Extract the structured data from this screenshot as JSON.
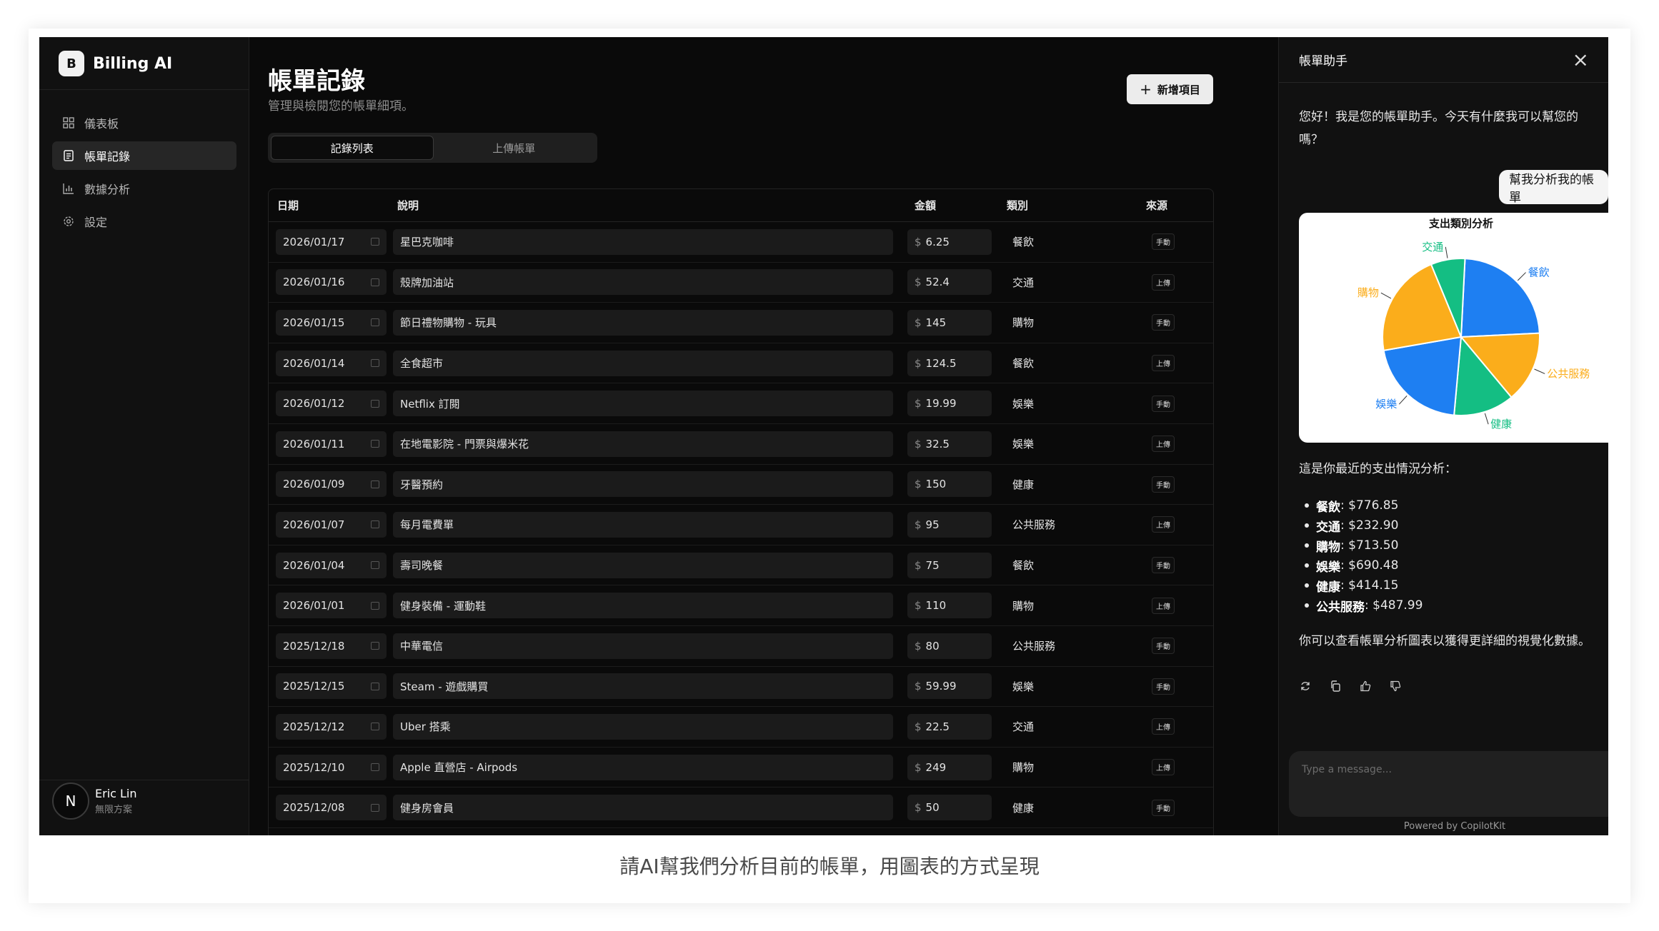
{
  "brand": {
    "logo_letter": "B",
    "name": "Billing AI"
  },
  "nav": [
    {
      "label": "儀表板",
      "icon": "dashboard-icon",
      "active": false
    },
    {
      "label": "帳單記錄",
      "icon": "receipt-icon",
      "active": true
    },
    {
      "label": "數據分析",
      "icon": "bar-chart-icon",
      "active": false
    },
    {
      "label": "設定",
      "icon": "gear-icon",
      "active": false
    }
  ],
  "user": {
    "initial": "N",
    "name": "Eric Lin",
    "plan": "無限方案"
  },
  "page": {
    "title": "帳單記錄",
    "subtitle": "管理與檢閱您的帳單細項。",
    "add_label": "新增項目"
  },
  "tabs": [
    {
      "label": "記錄列表",
      "active": true
    },
    {
      "label": "上傳帳單",
      "active": false
    }
  ],
  "table": {
    "headers": {
      "date": "日期",
      "desc": "說明",
      "amount": "金額",
      "category": "類別",
      "source": "來源"
    },
    "currency": "$",
    "rows": [
      {
        "date": "2026/01/17",
        "desc": "星巴克咖啡",
        "amount": "6.25",
        "category": "餐飲",
        "source": "手動"
      },
      {
        "date": "2026/01/16",
        "desc": "殼牌加油站",
        "amount": "52.4",
        "category": "交通",
        "source": "上傳"
      },
      {
        "date": "2026/01/15",
        "desc": "節日禮物購物 - 玩具",
        "amount": "145",
        "category": "購物",
        "source": "手動"
      },
      {
        "date": "2026/01/14",
        "desc": "全食超市",
        "amount": "124.5",
        "category": "餐飲",
        "source": "上傳"
      },
      {
        "date": "2026/01/12",
        "desc": "Netflix 訂閱",
        "amount": "19.99",
        "category": "娛樂",
        "source": "手動"
      },
      {
        "date": "2026/01/11",
        "desc": "在地電影院 - 門票與爆米花",
        "amount": "32.5",
        "category": "娛樂",
        "source": "上傳"
      },
      {
        "date": "2026/01/09",
        "desc": "牙醫預約",
        "amount": "150",
        "category": "健康",
        "source": "手動"
      },
      {
        "date": "2026/01/07",
        "desc": "每月電費單",
        "amount": "95",
        "category": "公共服務",
        "source": "上傳"
      },
      {
        "date": "2026/01/04",
        "desc": "壽司晚餐",
        "amount": "75",
        "category": "餐飲",
        "source": "手動"
      },
      {
        "date": "2026/01/01",
        "desc": "健身裝備 - 運動鞋",
        "amount": "110",
        "category": "購物",
        "source": "上傳"
      },
      {
        "date": "2025/12/18",
        "desc": "中華電信",
        "amount": "80",
        "category": "公共服務",
        "source": "手動"
      },
      {
        "date": "2025/12/15",
        "desc": "Steam - 遊戲購買",
        "amount": "59.99",
        "category": "娛樂",
        "source": "手動"
      },
      {
        "date": "2025/12/12",
        "desc": "Uber 搭乘",
        "amount": "22.5",
        "category": "交通",
        "source": "上傳"
      },
      {
        "date": "2025/12/10",
        "desc": "Apple 直營店 - Airpods",
        "amount": "249",
        "category": "購物",
        "source": "上傳"
      },
      {
        "date": "2025/12/08",
        "desc": "健身房會員",
        "amount": "50",
        "category": "健康",
        "source": "手動"
      }
    ]
  },
  "assistant": {
    "title": "帳單助手",
    "greeting": "您好！我是您的帳單助手。今天有什麼我可以幫您的嗎？",
    "user_message": "幫我分析我的帳單",
    "analysis_intro": "這是你最近的支出情況分析：",
    "breakdown": [
      {
        "label": "餐飲",
        "value": ": $776.85"
      },
      {
        "label": "交通",
        "value": ": $232.90"
      },
      {
        "label": "購物",
        "value": ": $713.50"
      },
      {
        "label": "娛樂",
        "value": ": $690.48"
      },
      {
        "label": "健康",
        "value": ": $414.15"
      },
      {
        "label": "公共服務",
        "value": ": $487.99"
      }
    ],
    "followup": "你可以查看帳單分析圖表以獲得更詳細的視覺化數據。",
    "input_placeholder": "Type a message...",
    "powered_by": "Powered by CopilotKit"
  },
  "chart_data": {
    "type": "pie",
    "title": "支出類別分析",
    "categories": [
      "餐飲",
      "公共服務",
      "健康",
      "娛樂",
      "購物",
      "交通"
    ],
    "values": [
      776.85,
      487.99,
      414.15,
      690.48,
      713.5,
      232.9
    ],
    "colors": [
      "#1e7ff2",
      "#fbad1b",
      "#14be83",
      "#1e7ff2",
      "#fbad1b",
      "#14be83"
    ]
  },
  "caption": "請AI幫我們分析目前的帳單，用圖表的方式呈現"
}
